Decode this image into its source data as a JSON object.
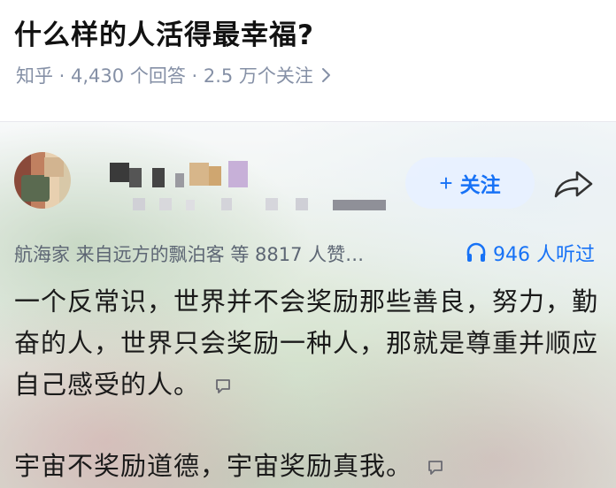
{
  "question": {
    "title": "什么样的人活得最幸福?",
    "meta": "知乎 · 4,430 个回答 · 2.5 万个关注"
  },
  "answer": {
    "follow_label": "关注",
    "upvote_text": "航海家 来自远方的飘泊客 等 8817 人赞…",
    "listen_text": "946 人听过",
    "paragraphs": [
      "一个反常识，世界并不会奖励那些善良，努力，勤奋的人，世界只会奖励一种人，那就是尊重并顺应自己感受的人。",
      "宇宙不奖励道德，宇宙奖励真我。"
    ]
  },
  "icons": {
    "chevron": "chevron-right-icon",
    "share": "share-icon",
    "headphone": "headphone-icon",
    "comment": "comment-bubble-icon",
    "plus": "plus-icon"
  },
  "colors": {
    "accent": "#1772f6",
    "meta_gray": "#8590a6",
    "text": "#1a1a1a"
  }
}
